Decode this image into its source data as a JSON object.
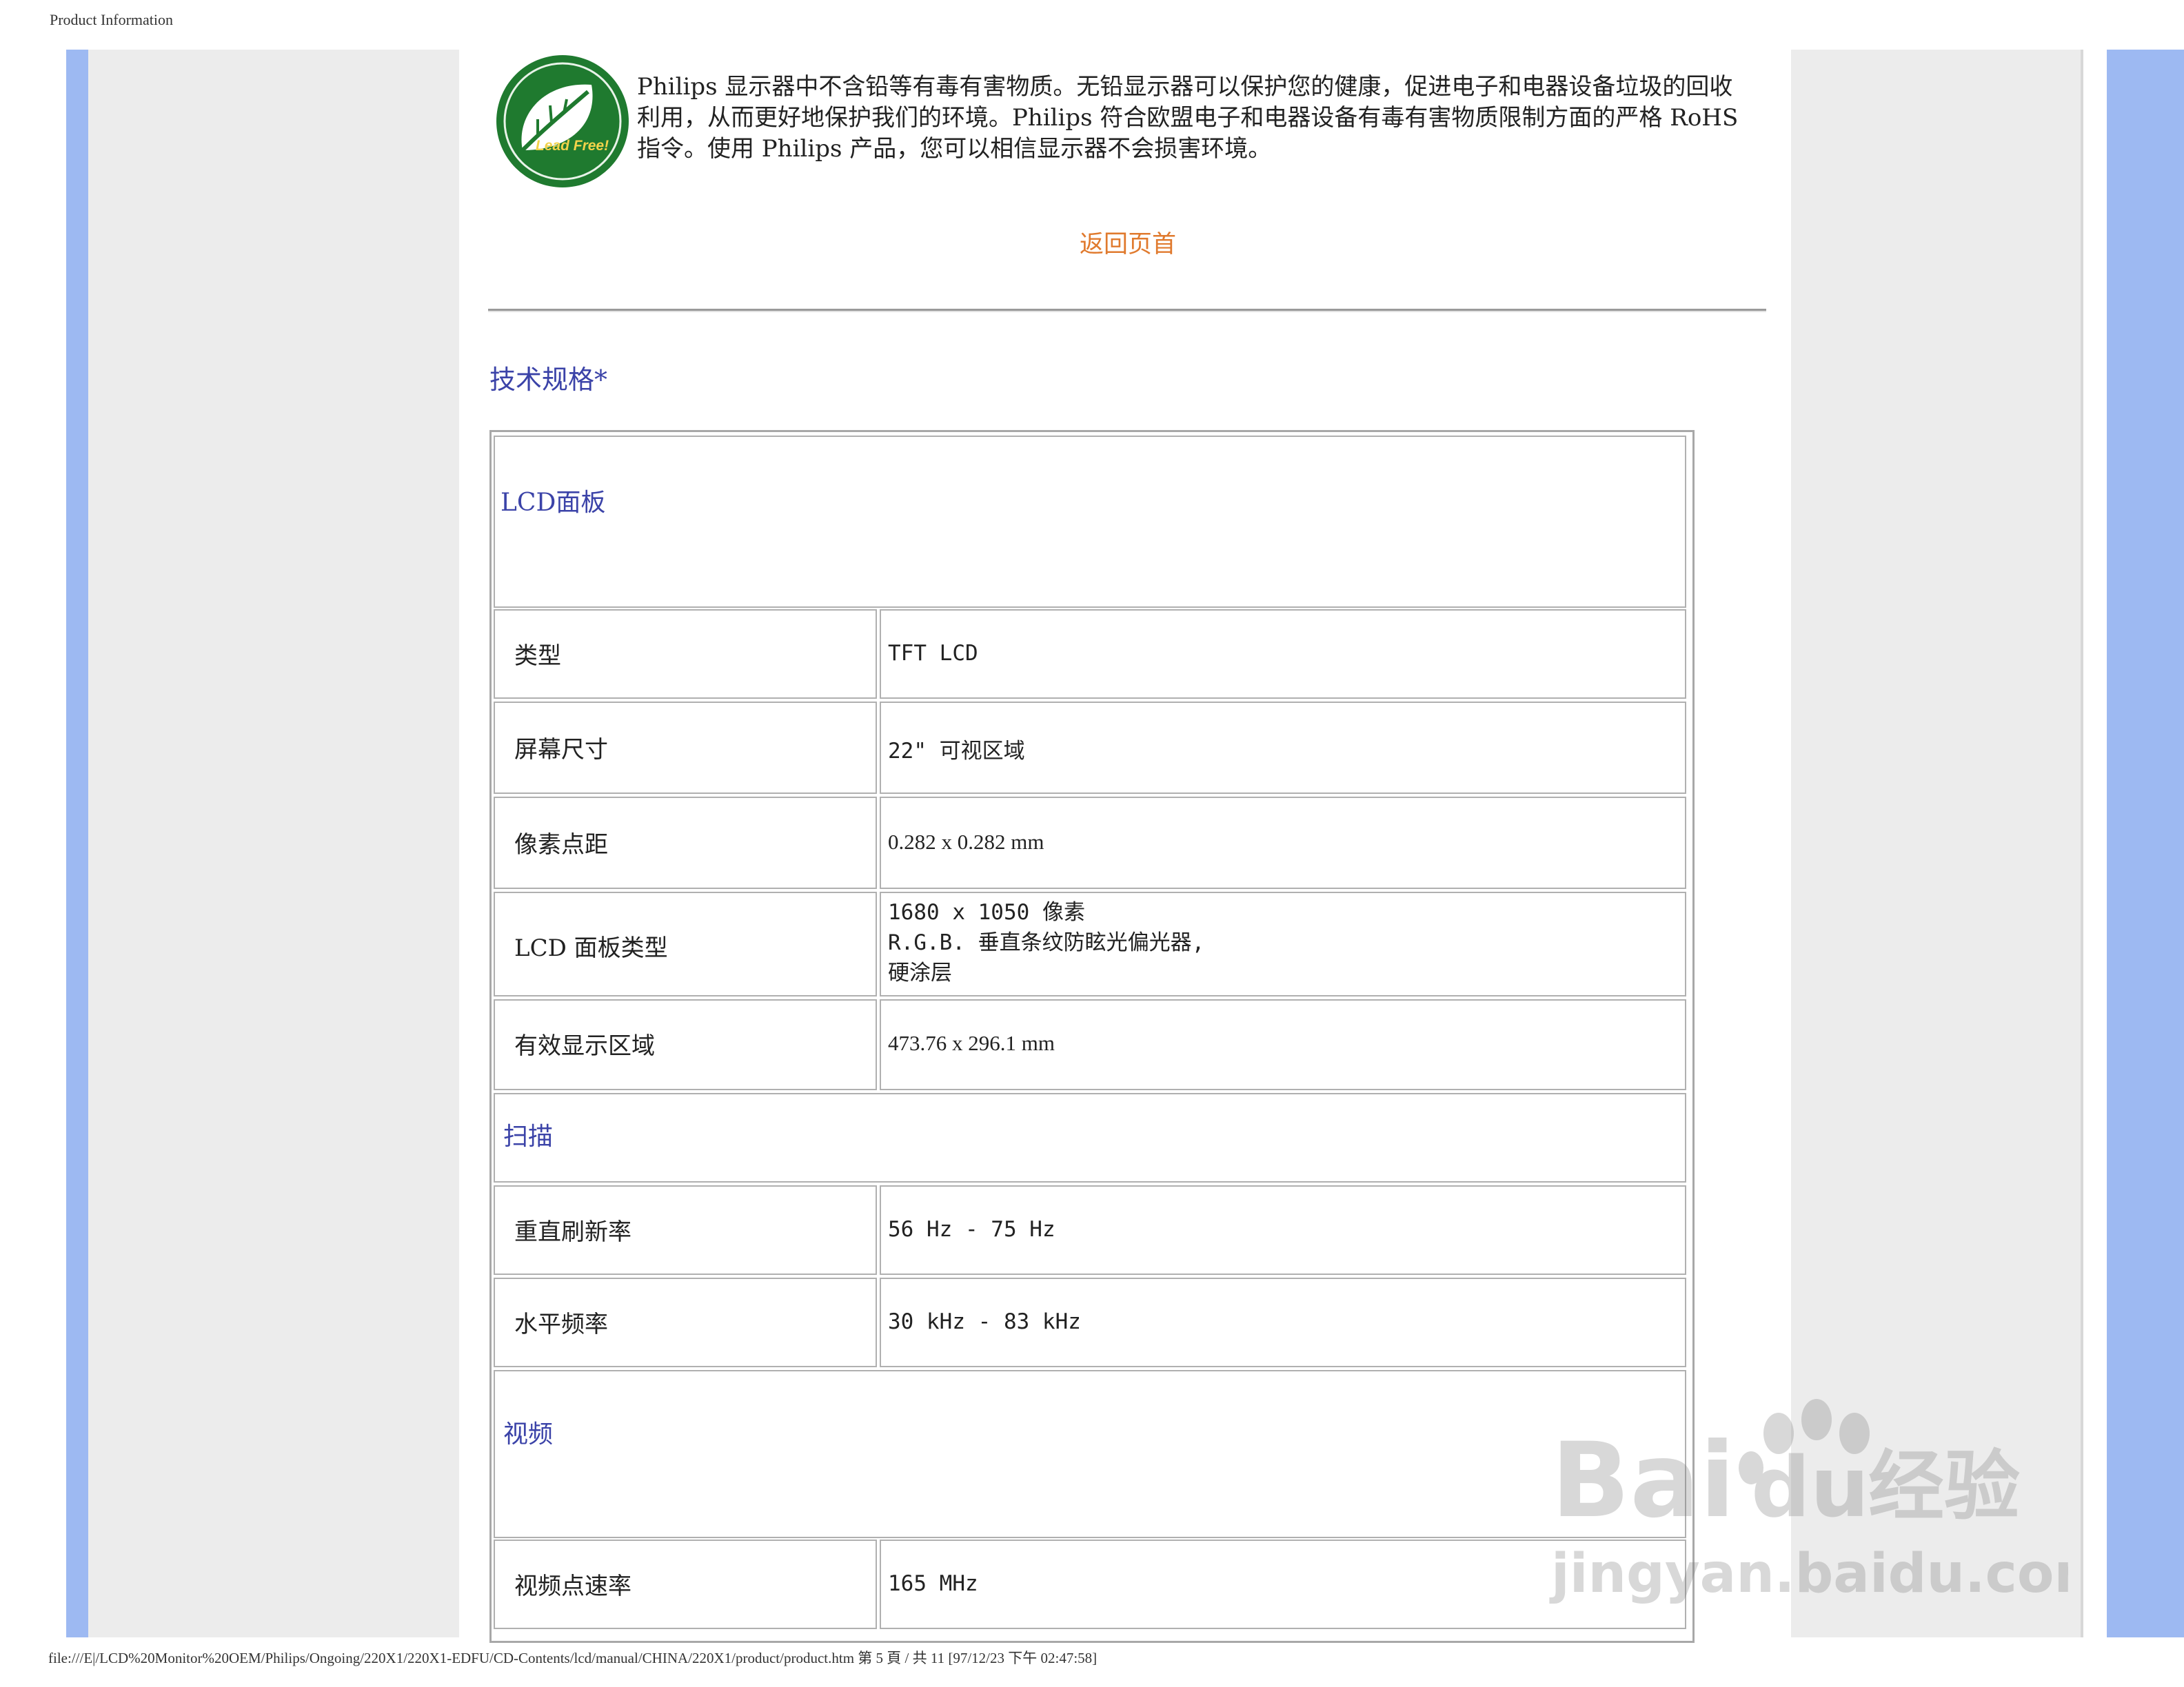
{
  "header": {
    "title": "Product Information"
  },
  "intro": {
    "logo_text": "Lead Free!",
    "text": "Philips 显示器中不含铅等有毒有害物质。无铅显示器可以保护您的健康，促进电子和电器设备垃圾的回收利用，从而更好地保护我们的环境。Philips 符合欧盟电子和电器设备有毒有害物质限制方面的严格 RoHS 指令。使用 Philips 产品，您可以相信显示器不会损害环境。"
  },
  "back_link": "返回页首",
  "spec": {
    "title": "技术规格*",
    "sections": {
      "lcd": "LCD面板",
      "scan": "扫描",
      "video": "视频"
    },
    "rows": [
      {
        "label": "类型",
        "value": "TFT LCD"
      },
      {
        "label": "屏幕尺寸",
        "value": "22\" 可视区域"
      },
      {
        "label": "像素点距",
        "value": "0.282 x 0.282 mm"
      },
      {
        "label": "LCD 面板类型",
        "value_lines": [
          "1680 x 1050 像素",
          "R.G.B. 垂直条纹防眩光偏光器,",
          "硬涂层"
        ]
      },
      {
        "label": "有效显示区域",
        "value": "473.76 x 296.1 mm"
      },
      {
        "label": "重直刷新率",
        "value": "56 Hz - 75 Hz"
      },
      {
        "label": "水平频率",
        "value": "30 kHz - 83 kHz"
      },
      {
        "label": "视频点速率",
        "value": "165 MHz"
      }
    ]
  },
  "watermark": {
    "brand": "Bai",
    "brand_suffix": "du",
    "brand_cn": "经验",
    "url": "jingyan.baidu.com"
  },
  "footer": "file:///E|/LCD%20Monitor%20OEM/Philips/Ongoing/220X1/220X1-EDFU/CD-Contents/lcd/manual/CHINA/220X1/product/product.htm 第 5 頁 / 共 11 [97/12/23 下午 02:47:58]",
  "colors": {
    "accent_blue": "#3b43a8",
    "link_orange": "#e07a2e",
    "side_blue": "#9db9f2",
    "logo_green": "#1f7a2f"
  }
}
